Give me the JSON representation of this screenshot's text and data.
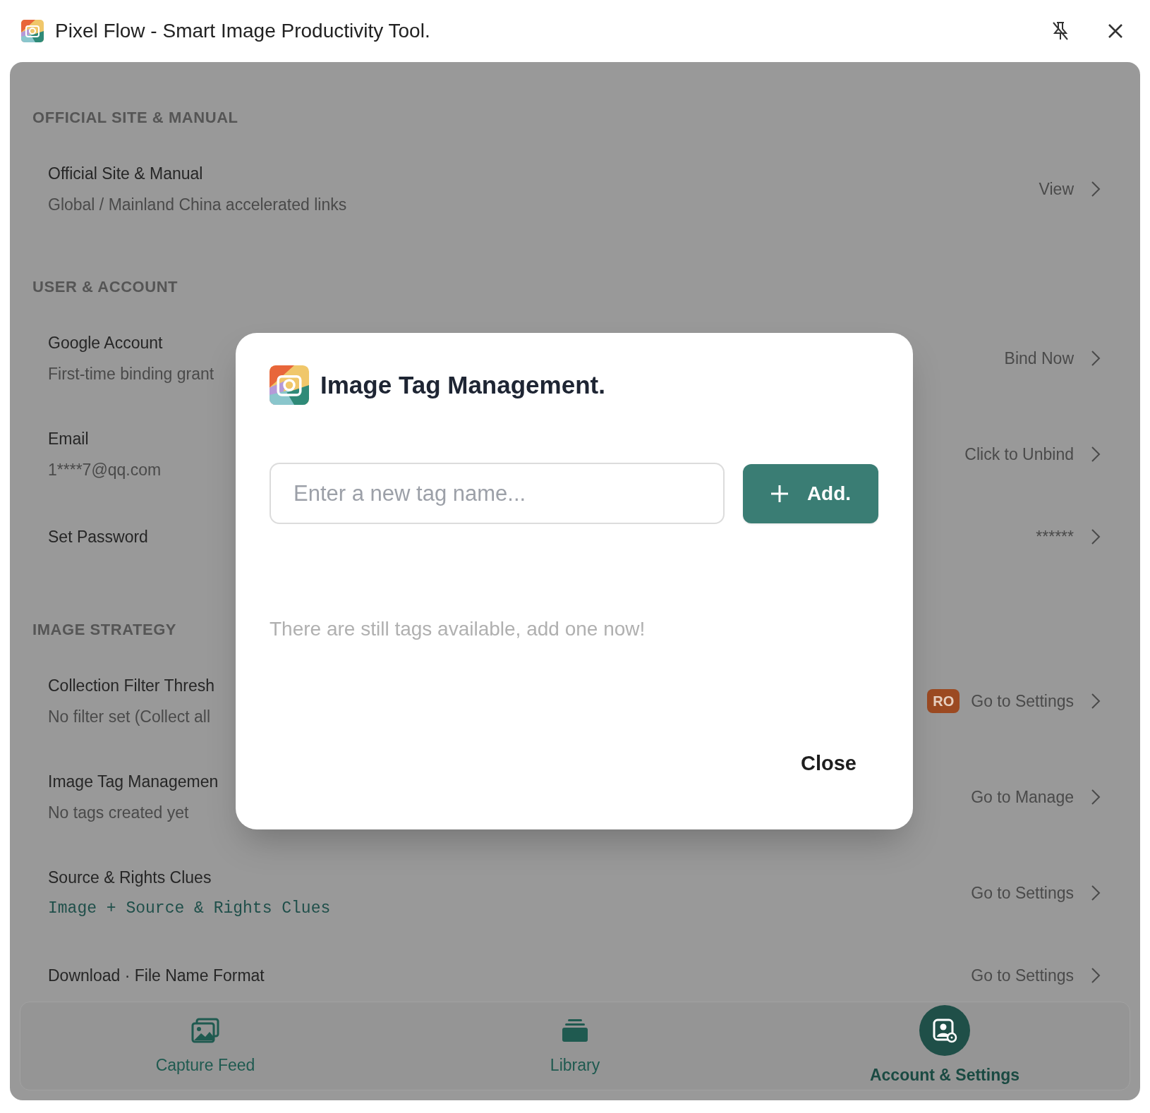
{
  "window": {
    "title": "Pixel Flow - Smart Image Productivity Tool."
  },
  "sections": [
    {
      "heading": "OFFICIAL SITE & MANUAL",
      "items": [
        {
          "title": "Official Site & Manual",
          "subtitle": {
            "kind": "plain",
            "text": "Global / Mainland China accelerated links"
          },
          "action": "View"
        }
      ]
    },
    {
      "heading": "USER & ACCOUNT",
      "items": [
        {
          "title": "Google Account",
          "subtitle": {
            "kind": "plain",
            "text": "First-time binding grant"
          },
          "action": "Bind Now"
        },
        {
          "title": "Email",
          "subtitle": {
            "kind": "plain",
            "text": "1****7@qq.com"
          },
          "action": "Click to Unbind"
        },
        {
          "title": "Set Password",
          "action": "******"
        }
      ]
    },
    {
      "heading": "IMAGE STRATEGY",
      "items": [
        {
          "title": "Collection Filter Thresh",
          "subtitle": {
            "kind": "plain",
            "text": "No filter set (Collect all"
          },
          "badge": "RO",
          "action": "Go to Settings"
        },
        {
          "title": "Image Tag Managemen",
          "subtitle": {
            "kind": "plain",
            "text": "No tags created yet"
          },
          "action": "Go to Manage"
        },
        {
          "title": "Source & Rights Clues",
          "subtitle": {
            "kind": "code",
            "text": "Image + Source & Rights Clues"
          },
          "action": "Go to Settings"
        },
        {
          "title": "Download · File Name Format",
          "action": "Go to Settings"
        }
      ]
    }
  ],
  "nav": [
    {
      "kind": "images",
      "label": "Capture Feed",
      "selected": false
    },
    {
      "kind": "stack",
      "label": "Library",
      "selected": false
    },
    {
      "kind": "account",
      "label": "Account & Settings",
      "selected": true
    }
  ],
  "modal": {
    "title": "Image Tag Management.",
    "input": {
      "placeholder": "Enter a new tag name..."
    },
    "add_button": "Add.",
    "empty_message": "There are still tags available, add one now!",
    "close_button": "Close"
  }
}
